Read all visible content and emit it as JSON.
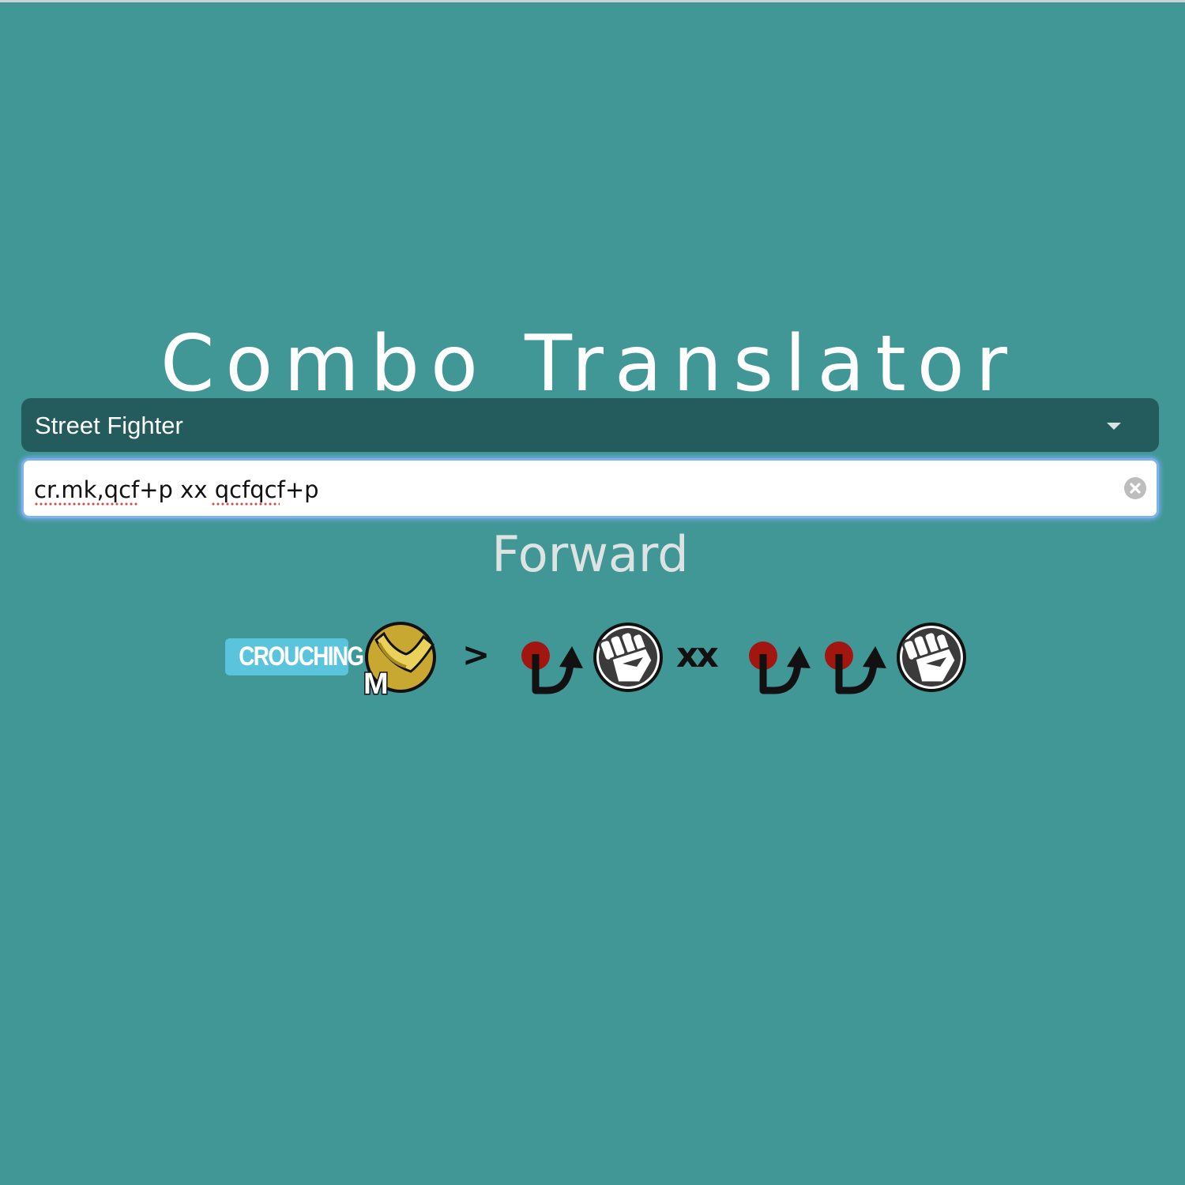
{
  "page": {
    "title": "Combo Translator",
    "subtitle": "Forward"
  },
  "game_select": {
    "selected": "Street Fighter"
  },
  "combo_input": {
    "value": "cr.mk,qcf+p xx qcfqcf+p"
  },
  "combo_output": {
    "crouching_badge": "CROUCHING",
    "kick_button_letter": "M",
    "link_symbol": ">",
    "cancel_symbol": "xx"
  },
  "colors": {
    "background": "#409795",
    "select_bg": "#245b5c",
    "badge": "#5bc4dd",
    "kick_gold": "#c9a832",
    "punch_dark": "#3b3b3b",
    "motion_dot": "#a2160f"
  },
  "icons": [
    "chevron-down-icon",
    "clear-icon",
    "medium-kick-icon",
    "qcf-motion-icon",
    "punch-icon"
  ]
}
